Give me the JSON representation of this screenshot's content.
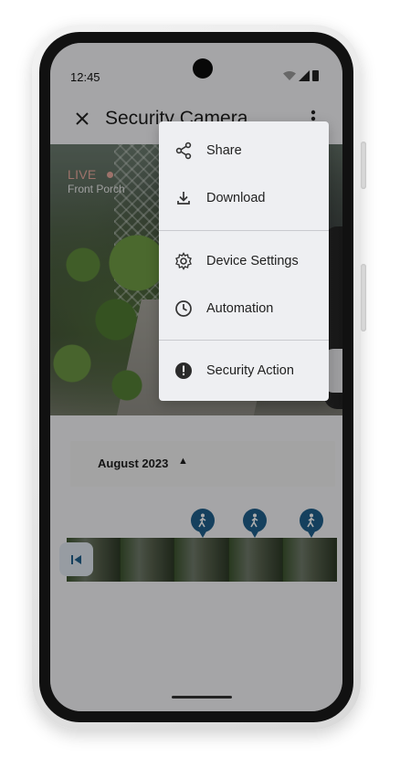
{
  "status_bar": {
    "time": "12:45"
  },
  "app_bar": {
    "title": "Security Camera"
  },
  "camera_feed": {
    "live_label": "LIVE",
    "camera_name": "Front Porch"
  },
  "overflow_menu": {
    "items": [
      {
        "label": "Share",
        "icon": "share-icon"
      },
      {
        "label": "Download",
        "icon": "download-icon"
      },
      {
        "label": "Device Settings",
        "icon": "gear-icon"
      },
      {
        "label": "Automation",
        "icon": "clock-icon"
      },
      {
        "label": "Security Action",
        "icon": "alert-icon"
      }
    ]
  },
  "timeline": {
    "month_label": "August 2023",
    "event_icon": "person-walking-icon"
  },
  "colors": {
    "accent": "#1f5f8b",
    "live": "#e7a99d",
    "menu_bg": "#eeeff2"
  }
}
